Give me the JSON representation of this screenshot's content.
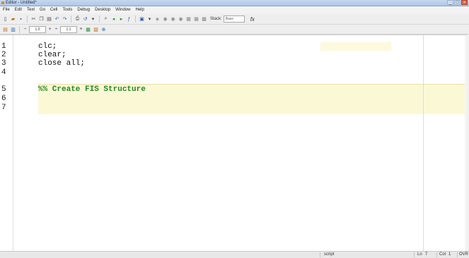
{
  "window": {
    "title": "Editor - Untitled*",
    "buttons": [
      "_",
      "□",
      "×"
    ]
  },
  "menu": [
    "File",
    "Edit",
    "Text",
    "Go",
    "Cell",
    "Tools",
    "Debug",
    "Desktop",
    "Window",
    "Help"
  ],
  "toolbar": {
    "stack_label": "Stack:",
    "stack_value": "Base",
    "fx_label": "fx"
  },
  "cell_toolbar": {
    "minus_sym": "−",
    "value1": "1.0",
    "plus_sym": "+",
    "divide_sym": "÷",
    "value2": "1.1",
    "times_sym": "×"
  },
  "editor": {
    "lines": [
      {
        "num": "1",
        "code": "clc;"
      },
      {
        "num": "2",
        "code": "clear;"
      },
      {
        "num": "3",
        "code": "close all;"
      },
      {
        "num": "4",
        "code": ""
      },
      {
        "num": "5",
        "code": "%% Create FIS Structure"
      },
      {
        "num": "6",
        "code": ""
      },
      {
        "num": "7",
        "code": ""
      }
    ]
  },
  "status": {
    "mode": "script",
    "ln_label": "Ln",
    "ln_value": "7",
    "col_label": "Col",
    "col_value": "1",
    "ovr": "OVR"
  }
}
